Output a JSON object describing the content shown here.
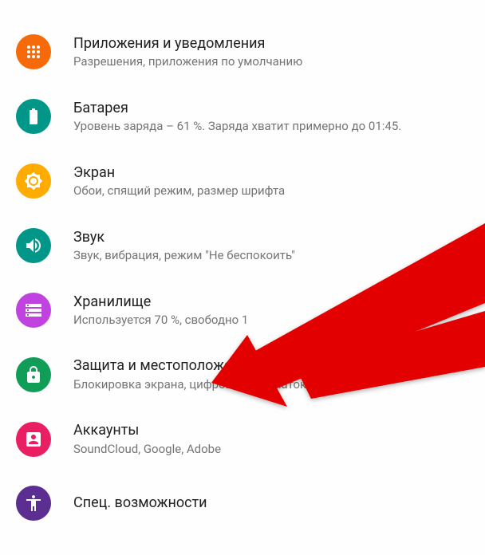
{
  "settings": {
    "items": [
      {
        "title": "Приложения и уведомления",
        "subtitle": "Разрешения, приложения по умолчанию"
      },
      {
        "title": "Батарея",
        "subtitle": "Уровень заряда – 61 %. Заряда хватит примерно до 01:45."
      },
      {
        "title": "Экран",
        "subtitle": "Обои, спящий режим, размер шрифта"
      },
      {
        "title": "Звук",
        "subtitle": "Звук, вибрация, режим \"Не беспокоить\""
      },
      {
        "title": "Хранилище",
        "subtitle": "Используется 70 %, свободно 1"
      },
      {
        "title": "Защита и местоположение",
        "subtitle": "Блокировка экрана, цифровой отпечаток"
      },
      {
        "title": "Аккаунты",
        "subtitle": "SoundCloud, Google, Adobe"
      },
      {
        "title": "Спец. возможности",
        "subtitle": ""
      }
    ]
  }
}
